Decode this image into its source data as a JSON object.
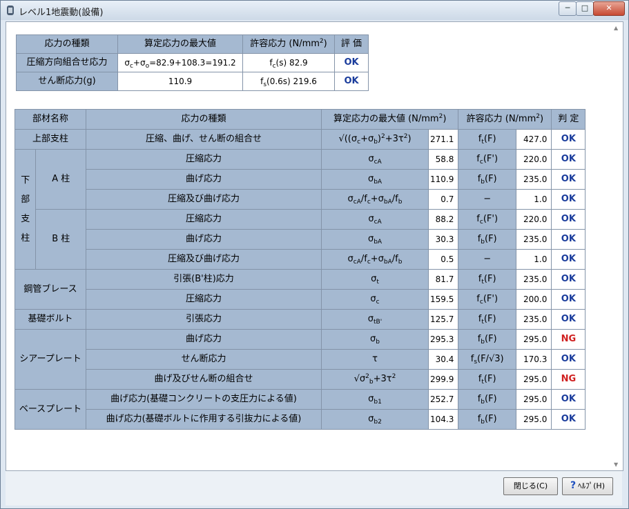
{
  "window": {
    "title": "レベル1地震動(設備)",
    "minimize": "─",
    "maximize": "□",
    "close": "✕"
  },
  "summary": {
    "headers": [
      "応力の種類",
      "算定応力の最大値",
      "許容応力 (N/mm²)",
      "評 価"
    ],
    "rows": [
      {
        "type": "圧縮方向組合せ応力",
        "max": "σc+σo=82.9+108.3=191.2",
        "allow": "fc(s) 82.9",
        "eval": "OK"
      },
      {
        "type": "せん断応力(g)",
        "max": "110.9",
        "allow": "fs(0.6s) 219.6",
        "eval": "OK"
      }
    ]
  },
  "detail": {
    "headers": [
      "部材名称",
      "応力の種類",
      "算定応力の最大値 (N/mm²)",
      "許容応力 (N/mm²)",
      "判 定"
    ],
    "rows": [
      {
        "member": "上部支柱",
        "type": "圧縮、曲げ、せん断の組合せ",
        "formula": "√((σc+σb)²+3τ²)",
        "max": "271.1",
        "allowSym": "ft(F)",
        "allow": "427.0",
        "judge": "OK"
      },
      {
        "member": "下部支柱",
        "sub": "A 柱",
        "type": "圧縮応力",
        "formula": "σcA",
        "max": "58.8",
        "allowSym": "fc(F')",
        "allow": "220.0",
        "judge": "OK"
      },
      {
        "type": "曲げ応力",
        "formula": "σbA",
        "max": "110.9",
        "allowSym": "fb(F)",
        "allow": "235.0",
        "judge": "OK"
      },
      {
        "type": "圧縮及び曲げ応力",
        "formula": "σcA/fc+σbA/fb",
        "max": "0.7",
        "allowSym": "−",
        "allow": "1.0",
        "judge": "OK"
      },
      {
        "sub": "B 柱",
        "type": "圧縮応力",
        "formula": "σcA",
        "max": "88.2",
        "allowSym": "fc(F')",
        "allow": "220.0",
        "judge": "OK"
      },
      {
        "type": "曲げ応力",
        "formula": "σbA",
        "max": "30.3",
        "allowSym": "fb(F)",
        "allow": "235.0",
        "judge": "OK"
      },
      {
        "type": "圧縮及び曲げ応力",
        "formula": "σcA/fc+σbA/fb",
        "max": "0.5",
        "allowSym": "−",
        "allow": "1.0",
        "judge": "OK"
      },
      {
        "member": "鋼管ブレース",
        "type": "引張(B'柱)応力",
        "formula": "σt",
        "max": "81.7",
        "allowSym": "ft(F)",
        "allow": "235.0",
        "judge": "OK"
      },
      {
        "type": "圧縮応力",
        "formula": "σc",
        "max": "159.5",
        "allowSym": "fc(F')",
        "allow": "200.0",
        "judge": "OK"
      },
      {
        "member": "基礎ボルト",
        "type": "引張応力",
        "formula": "σtB'",
        "max": "125.7",
        "allowSym": "ft(F)",
        "allow": "235.0",
        "judge": "OK"
      },
      {
        "member": "シアープレート",
        "type": "曲げ応力",
        "formula": "σb",
        "max": "295.3",
        "allowSym": "fb(F)",
        "allow": "295.0",
        "judge": "NG"
      },
      {
        "type": "せん断応力",
        "formula": "τ",
        "max": "30.4",
        "allowSym": "fs(F/√3)",
        "allow": "170.3",
        "judge": "OK"
      },
      {
        "type": "曲げ及びせん断の組合せ",
        "formula": "√σ²b+3τ²",
        "max": "299.9",
        "allowSym": "ft(F)",
        "allow": "295.0",
        "judge": "NG"
      },
      {
        "member": "ベースプレート",
        "type": "曲げ応力(基礎コンクリートの支圧力による値)",
        "formula": "σb1",
        "max": "252.7",
        "allowSym": "fb(F)",
        "allow": "295.0",
        "judge": "OK"
      },
      {
        "type": "曲げ応力(基礎ボルトに作用する引抜力による値)",
        "formula": "σb2",
        "max": "104.3",
        "allowSym": "fb(F)",
        "allow": "295.0",
        "judge": "OK"
      }
    ]
  },
  "buttons": {
    "close": "閉じる(C)",
    "help": "ﾍﾙﾌﾟ(H)"
  },
  "colors": {
    "header": "#a5b9d1",
    "ok": "#1a3c9c",
    "ng": "#d02020"
  }
}
